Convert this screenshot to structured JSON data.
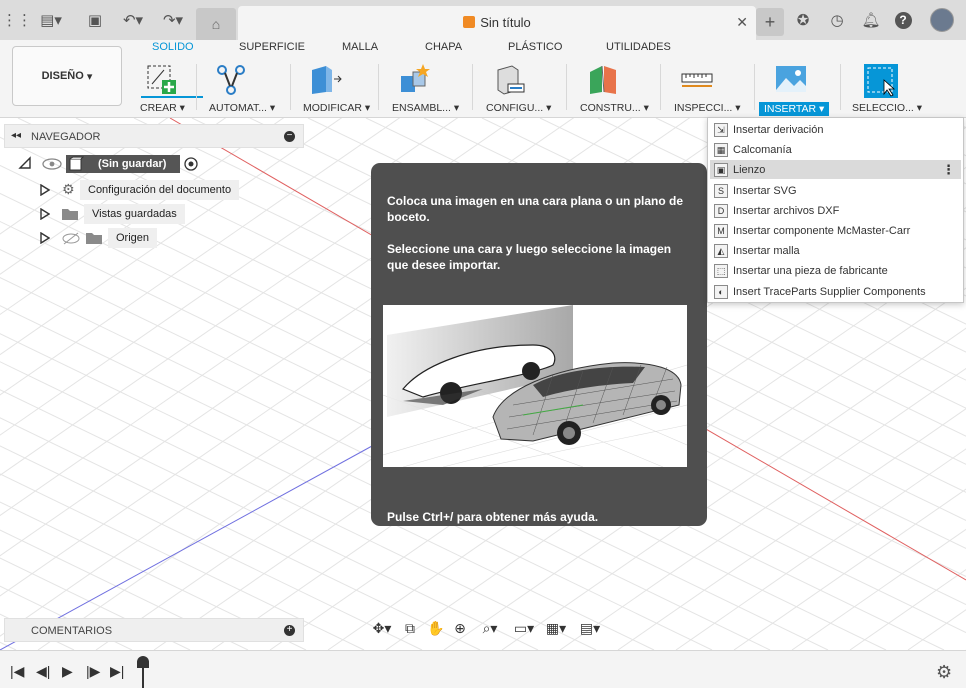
{
  "document": {
    "title": "Sin título"
  },
  "topbar": {
    "icons": [
      "apps-grid-icon",
      "file-icon",
      "save-icon",
      "undo-icon",
      "redo-icon",
      "home-icon",
      "close-icon",
      "new-tab-icon",
      "extensions-icon",
      "job-status-icon",
      "notifications-icon",
      "help-icon",
      "avatar"
    ]
  },
  "workspace": {
    "mode_label": "DISEÑO"
  },
  "ribbon": {
    "tabs": [
      {
        "label": "SOLIDO",
        "active": true
      },
      {
        "label": "SUPERFICIE",
        "active": false
      },
      {
        "label": "MALLA",
        "active": false
      },
      {
        "label": "CHAPA",
        "active": false
      },
      {
        "label": "PLÁSTICO",
        "active": false
      },
      {
        "label": "UTILIDADES",
        "active": false
      }
    ],
    "groups": [
      {
        "label": "CREAR ▾",
        "icon": "create-sketch-icon"
      },
      {
        "label": "AUTOMAT... ▾",
        "icon": "automate-icon"
      },
      {
        "label": "MODIFICAR ▾",
        "icon": "modify-icon"
      },
      {
        "label": "ENSAMBL... ▾",
        "icon": "assemble-icon"
      },
      {
        "label": "CONFIGU... ▾",
        "icon": "configure-icon"
      },
      {
        "label": "CONSTRU... ▾",
        "icon": "construct-icon"
      },
      {
        "label": "INSPECCI... ▾",
        "icon": "inspect-icon"
      },
      {
        "label": "INSERTAR ▾",
        "icon": "insert-image-icon"
      },
      {
        "label": "SELECCIO... ▾",
        "icon": "select-icon"
      }
    ],
    "accent": "#0696d7"
  },
  "navigator": {
    "title": "NAVEGADOR",
    "root": "(Sin guardar)",
    "items": [
      {
        "label": "Configuración del documento",
        "icon": "gear-icon"
      },
      {
        "label": "Vistas guardadas",
        "icon": "folder-icon"
      },
      {
        "label": "Origen",
        "icon": "folder-icon"
      }
    ]
  },
  "comments": {
    "title": "COMENTARIOS"
  },
  "tooltip": {
    "para1": "Coloca una imagen en una cara plana o un plano de boceto.",
    "para2": "Seleccione una cara y luego seleccione la imagen que desee importar.",
    "footer": "Pulse Ctrl+/ para obtener más ayuda."
  },
  "insert_menu": {
    "items": [
      {
        "label": "Insertar derivación",
        "icon": "derive-icon",
        "glyph": "⇲",
        "highlighted": false
      },
      {
        "label": "Calcomanía",
        "icon": "decal-icon",
        "glyph": "▦",
        "highlighted": false
      },
      {
        "label": "Lienzo",
        "icon": "canvas-icon",
        "glyph": "▣",
        "highlighted": true
      },
      {
        "label": "Insertar SVG",
        "icon": "svg-icon",
        "glyph": "S",
        "highlighted": false
      },
      {
        "label": "Insertar archivos DXF",
        "icon": "dxf-icon",
        "glyph": "D",
        "highlighted": false
      },
      {
        "label": "Insertar componente McMaster-Carr",
        "icon": "mcmaster-icon",
        "glyph": "M",
        "highlighted": false
      },
      {
        "label": "Insertar malla",
        "icon": "mesh-icon",
        "glyph": "◭",
        "highlighted": false
      },
      {
        "label": "Insertar una pieza de fabricante",
        "icon": "manufacturer-part-icon",
        "glyph": "⬚",
        "highlighted": false
      },
      {
        "label": "Insert TraceParts Supplier Components",
        "icon": "traceparts-icon",
        "glyph": "◐",
        "highlighted": false
      }
    ]
  },
  "navbar": {
    "icons": [
      "orbit-icon",
      "look-at-icon",
      "pan-icon",
      "zoom-icon",
      "fit-icon",
      "display-settings-icon",
      "grid-settings-icon",
      "viewports-icon"
    ]
  },
  "timeline": {
    "icons": [
      "go-to-start-icon",
      "step-back-icon",
      "play-icon",
      "step-forward-icon",
      "go-to-end-icon",
      "timeline-settings-icon"
    ]
  }
}
